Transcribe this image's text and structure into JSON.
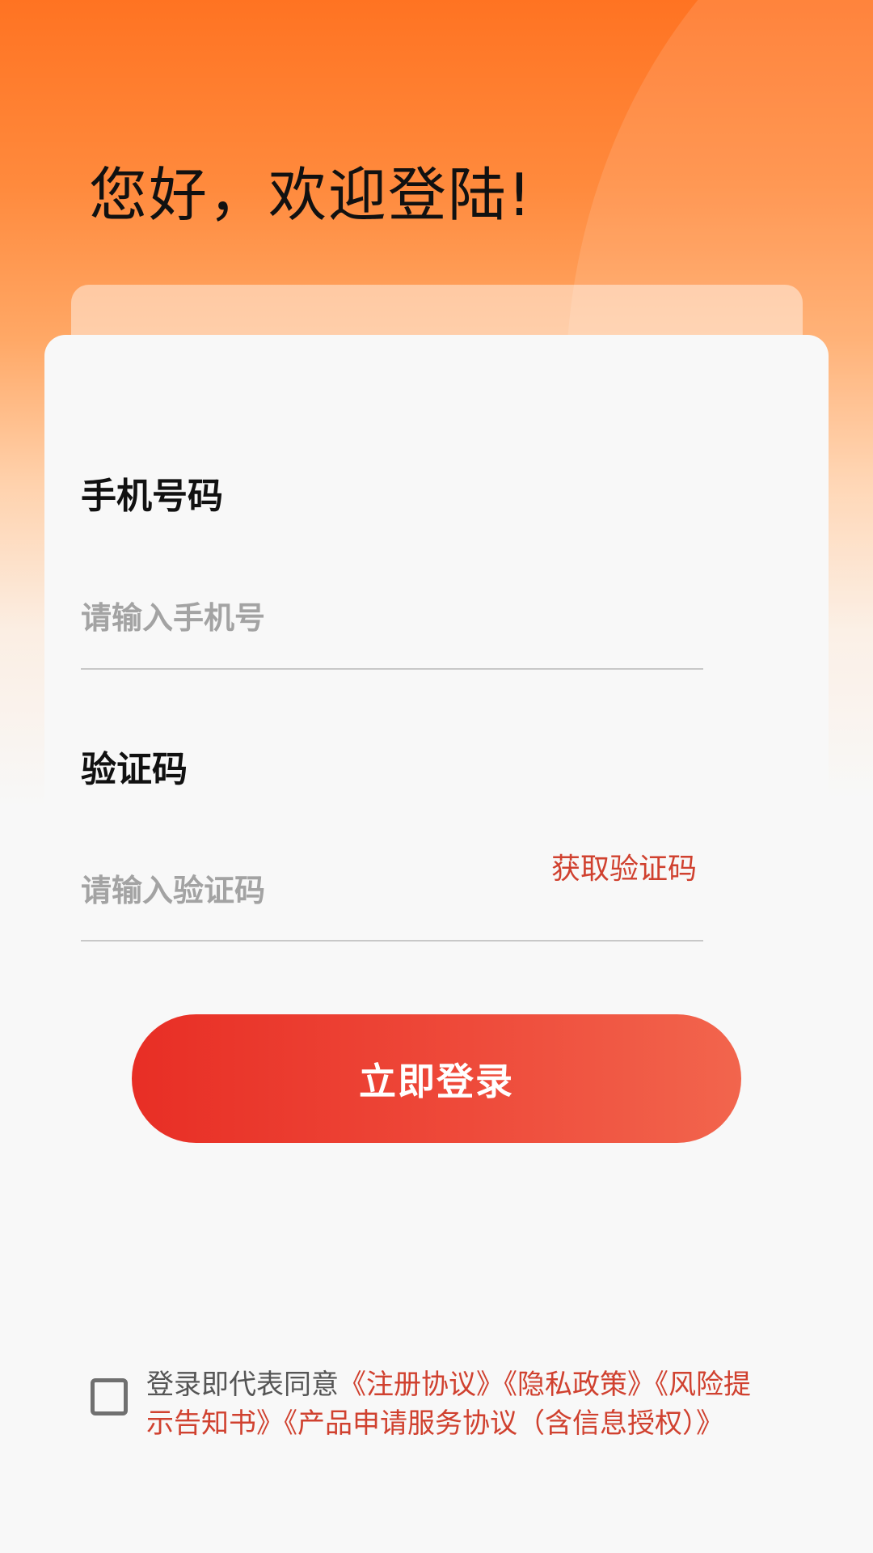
{
  "header": {
    "greeting": "您好，欢迎登陆!"
  },
  "form": {
    "phone_label": "手机号码",
    "phone_placeholder": "请输入手机号",
    "phone_value": "",
    "code_label": "验证码",
    "code_placeholder": "请输入验证码",
    "code_value": "",
    "get_code_label": "获取验证码",
    "login_label": "立即登录"
  },
  "agreement": {
    "checked": false,
    "prefix": "登录即代表同意",
    "links": [
      "《注册协议》",
      "《隐私政策》",
      "《风险提示告知书》",
      "《产品申请服务协议（含信息授权）》"
    ]
  },
  "colors": {
    "accent": "#d0412f",
    "button_start": "#e82e25",
    "button_end": "#f2654d",
    "header_orange": "#ff7322"
  }
}
